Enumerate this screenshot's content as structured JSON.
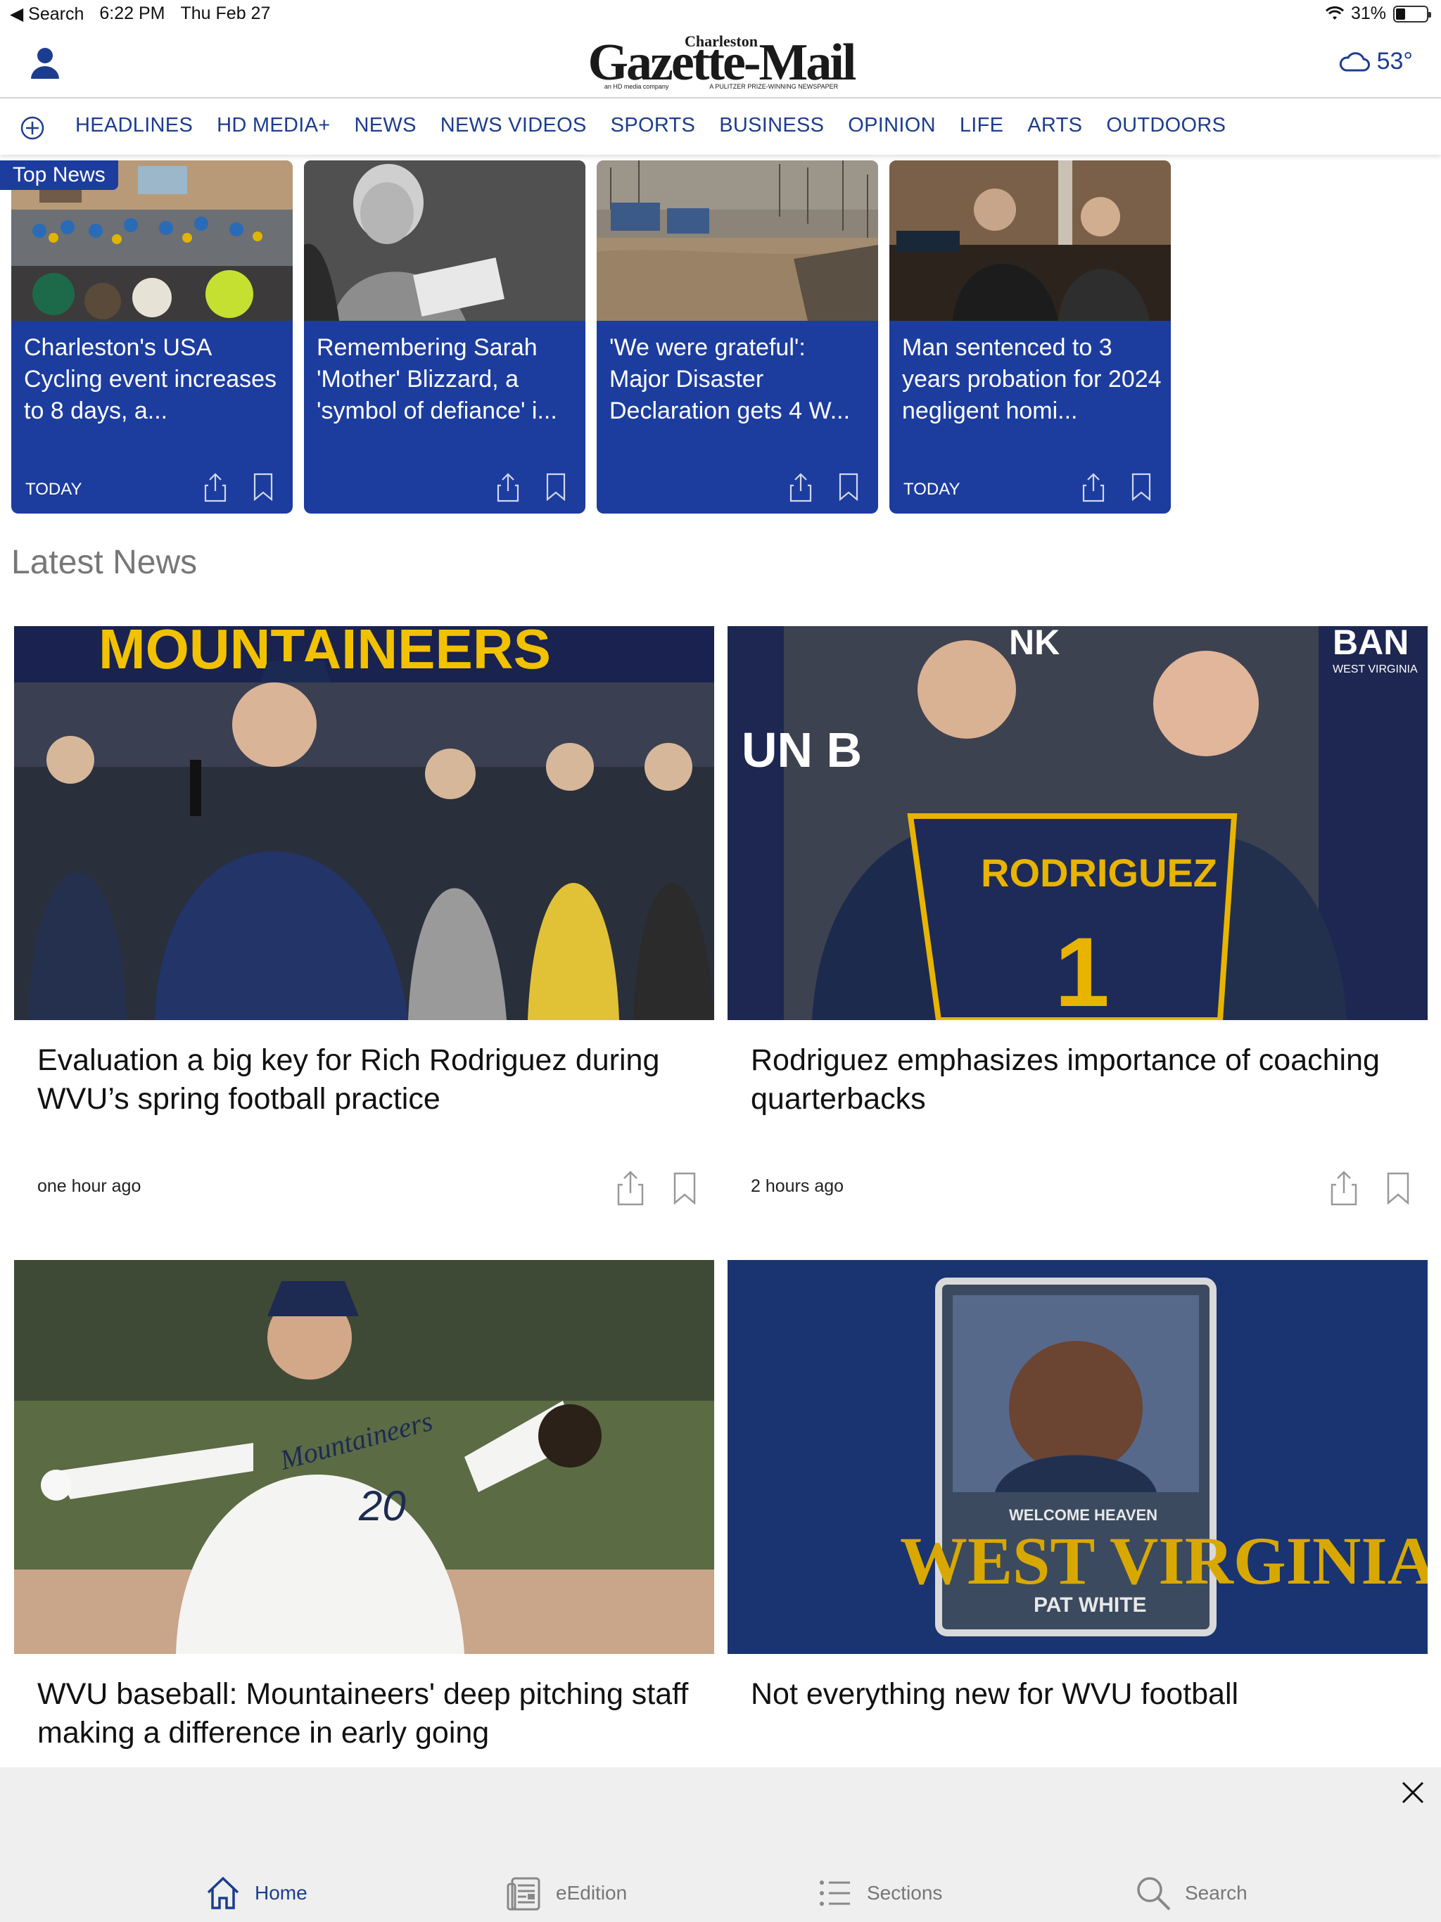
{
  "status_bar": {
    "back_label": "◀ Search",
    "time": "6:22 PM",
    "date": "Thu Feb 27",
    "battery": "31%",
    "battery_level": 0.31
  },
  "header": {
    "logo_small": "Charleston",
    "logo_main": "Gazette-Mail",
    "logo_tag_left": "an HD media company",
    "logo_tag_right": "A PULITZER PRIZE-WINNING NEWSPAPER",
    "weather_temp": "53°"
  },
  "nav": {
    "items": [
      "HEADLINES",
      "HD MEDIA+",
      "NEWS",
      "NEWS VIDEOS",
      "SPORTS",
      "BUSINESS",
      "OPINION",
      "LIFE",
      "ARTS",
      "OUTDOORS"
    ]
  },
  "top_news": {
    "badge": "Top News",
    "cards": [
      {
        "title": "Charleston's USA Cycling event increases to 8 days, a...",
        "date": "TODAY"
      },
      {
        "title": "Remembering Sarah 'Mother' Blizzard, a 'symbol of defiance' i...",
        "date": ""
      },
      {
        "title": "'We were grateful': Major Disaster Declaration gets 4 W...",
        "date": ""
      },
      {
        "title": "Man sentenced to 3 years probation for 2024 negligent homi...",
        "date": "TODAY"
      }
    ]
  },
  "latest": {
    "title": "Latest News",
    "articles": [
      {
        "headline": "Evaluation a big key for Rich Rodriguez during WVU’s spring football practice",
        "meta": "one hour ago",
        "img_text": "MOUNTAINEERS"
      },
      {
        "headline": "Rodriguez emphasizes importance of coaching quarterbacks",
        "meta": "2 hours ago",
        "img_text": "RODRIGUEZ",
        "jersey_number": "1",
        "sign_left": "UN B",
        "sign_right": "BAN",
        "sign_right_small": "WEST VIRGINIA",
        "sign_top": "NK"
      },
      {
        "headline": "WVU baseball: Mountaineers' deep pitching staff making a difference in early going",
        "meta": "",
        "jersey_text": "Mountaineers",
        "jersey_number": "20"
      },
      {
        "headline": "Not everything new for WVU football",
        "meta": "",
        "card_top": "WELCOME HEAVEN",
        "card_main": "WEST VIRGINIA",
        "card_name": "PAT WHITE"
      }
    ]
  },
  "tab_bar": {
    "tabs": [
      "Home",
      "eEdition",
      "Sections",
      "Search"
    ]
  },
  "colors": {
    "brand_blue": "#1c3d9e",
    "nav_blue": "#1c3d8f"
  }
}
